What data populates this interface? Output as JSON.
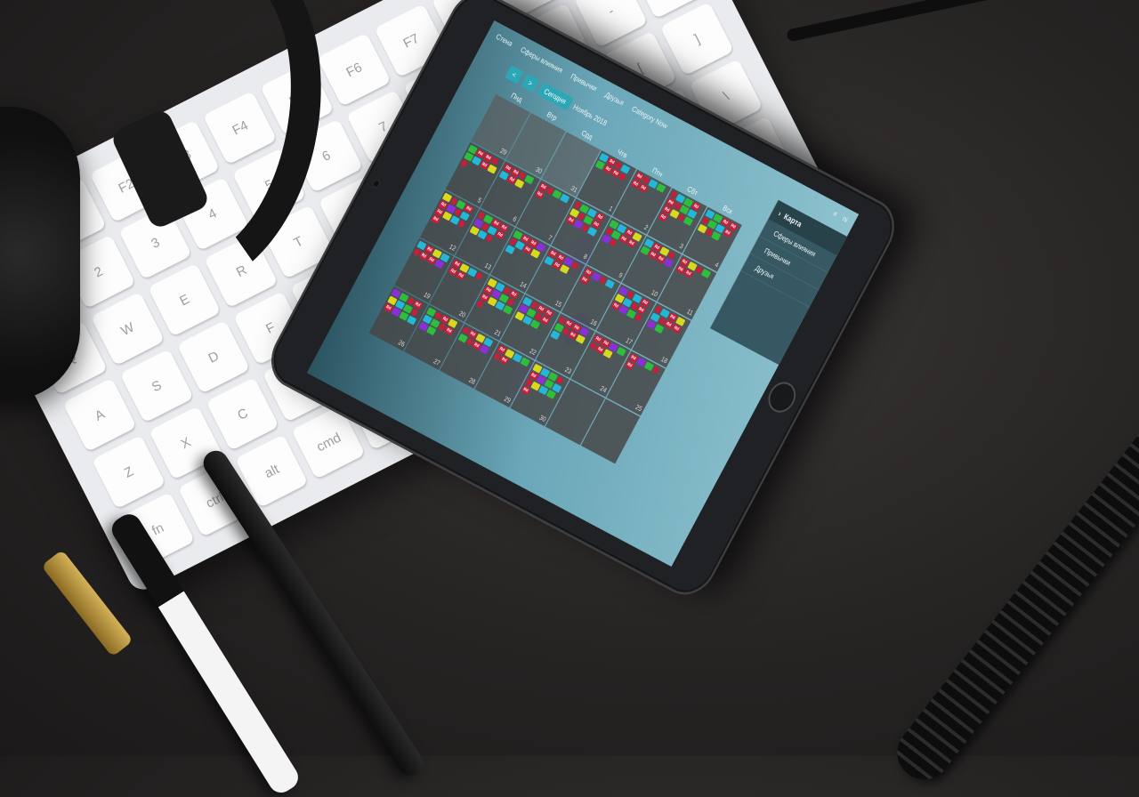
{
  "app": {
    "nav": [
      "Стена",
      "Сферы влияния",
      "Привычки",
      "Друзья",
      "Category Now"
    ],
    "top_icons": [
      "≡",
      "ni"
    ],
    "sidebar": {
      "title": "Карта",
      "items": [
        "Сферы влияния",
        "Привычки",
        "Друзья"
      ]
    },
    "controls": {
      "prev": "<",
      "next": ">",
      "today": "Сегодня",
      "month": "Ноябрь 2018"
    },
    "weekdays": [
      "Пнд",
      "Втр",
      "Срд",
      "Чтв",
      "Птн",
      "Сбт",
      "Вск"
    ],
    "days": [
      "29",
      "30",
      "31",
      "1",
      "2",
      "3",
      "4",
      "5",
      "6",
      "7",
      "8",
      "9",
      "10",
      "11",
      "12",
      "13",
      "14",
      "15",
      "16",
      "17",
      "18",
      "19",
      "20",
      "21",
      "22",
      "23",
      "24",
      "25",
      "26",
      "27",
      "28",
      "29",
      "30",
      "",
      ""
    ],
    "tag_text": "Rd",
    "colors": {
      "accent": "#2ba7b5",
      "red": "#c81e3a",
      "purple": "#8b2fd8",
      "green": "#2fbd3e",
      "cyan": "#25b7d8",
      "yellow": "#d8d81e"
    }
  }
}
